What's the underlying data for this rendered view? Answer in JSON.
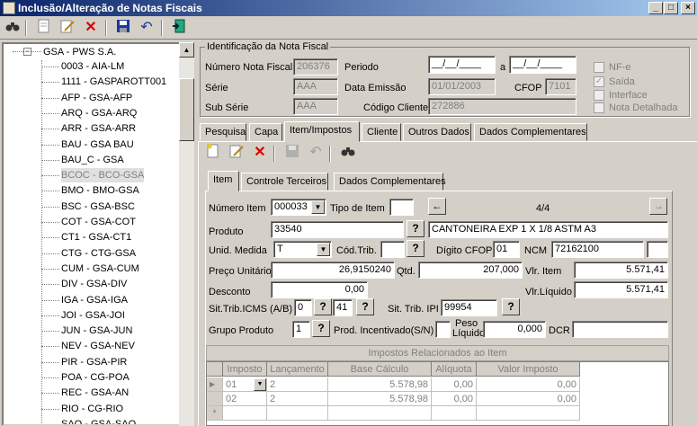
{
  "window": {
    "title": "Inclusão/Alteração de Notas Fiscais",
    "minimize": "_",
    "maximize": "□",
    "close": "×"
  },
  "toolbar": {
    "find": "find-icon",
    "new": "new-document-icon",
    "edit": "edit-icon",
    "delete": "delete-icon",
    "save": "save-icon",
    "undo": "undo-icon",
    "exit": "exit-door-icon"
  },
  "tree": {
    "root": "GSA - PWS S.A.",
    "items": [
      "0003 - AIA-LM",
      "1111 - GASPAROTT001",
      "AFP - GSA-AFP",
      "ARQ - GSA-ARQ",
      "ARR - GSA-ARR",
      "BAU - GSA BAU",
      "BAU_C - GSA",
      "BCOC - BCO-GSA",
      "BMO - BMO-GSA",
      "BSC - GSA-BSC",
      "COT - GSA-COT",
      "CT1 - GSA-CT1",
      "CTG - CTG-GSA",
      "CUM - GSA-CUM",
      "DIV - GSA-DIV",
      "IGA - GSA-IGA",
      "JOI - GSA-JOI",
      "JUN - GSA-JUN",
      "NEV - GSA-NEV",
      "PIR - GSA-PIR",
      "POA - CG-POA",
      "REC - GSA-AN",
      "RIO - CG-RIO",
      "SAO - GSA-SAO"
    ],
    "selected_index": 7
  },
  "ident": {
    "legend": "Identificação da Nota Fiscal",
    "numero_label": "Número Nota Fiscal",
    "numero": "206376",
    "periodo_label": "Periodo",
    "periodo_de": "__/__/____",
    "periodo_a_label": "a",
    "periodo_ate": "__/__/____",
    "serie_label": "Série",
    "serie": "AAA",
    "data_emissao_label": "Data Emissão",
    "data_emissao": "01/01/2003",
    "cfop_label": "CFOP",
    "cfop": "7101",
    "sub_serie_label": "Sub Série",
    "sub_serie": "AAA",
    "codigo_cliente_label": "Código Cliente",
    "codigo_cliente": "272886",
    "checks": [
      {
        "label": "NF-e",
        "checked": false
      },
      {
        "label": "Saída",
        "checked": true
      },
      {
        "label": "Interface",
        "checked": false
      },
      {
        "label": "Nota Detalhada",
        "checked": false
      }
    ]
  },
  "tabs": [
    "Pesquisa",
    "Capa",
    "Item/Impostos",
    "Cliente",
    "Outros Dados",
    "Dados Complementares"
  ],
  "subtoolbar": {
    "new": "new-item-icon",
    "edit": "edit-item-icon",
    "delete": "delete-item-icon",
    "save": "save-item-icon",
    "undo": "undo-item-icon",
    "find": "find-item-icon"
  },
  "subtabs": [
    "Item",
    "Controle Terceiros",
    "Dados Complementares"
  ],
  "item": {
    "numero_item_label": "Número Item",
    "numero_item": "000033",
    "tipo_item_label": "Tipo de Item",
    "tipo_item": "",
    "counter": "4/4",
    "produto_label": "Produto",
    "produto": "33540",
    "produto_desc": "CANTONEIRA EXP 1 X 1/8 ASTM A3",
    "unid_medida_label": "Unid. Medida",
    "unid_medida": "T",
    "cod_trib_label": "Cód.Trib.",
    "cod_trib": "",
    "digito_cfop_label": "Dígito CFOP",
    "digito_cfop": "01",
    "ncm_label": "NCM",
    "ncm": "72162100",
    "ncm_extra": "",
    "preco_label": "Preço Unitário",
    "preco": "26,9150240",
    "qtd_label": "Qtd.",
    "qtd": "207,000",
    "vlr_item_label": "Vlr. Item",
    "vlr_item": "5.571,41",
    "desconto_label": "Desconto",
    "desconto": "0,00",
    "vlr_liquido_label": "Vlr.Líquido",
    "vlr_liquido": "5.571,41",
    "sit_icms_label": "Sit.Trib.ICMS (A/B)",
    "sit_icms_a": "0",
    "sit_icms_b": "41",
    "sit_ipi_label": "Sit. Trib. IPI",
    "sit_ipi": "99954",
    "grupo_label": "Grupo Produto",
    "grupo": "1",
    "prod_incent_label": "Prod. Incentivado(S/N)",
    "prod_incent": "",
    "peso_label_1": "Peso",
    "peso_label_2": "Líquido",
    "peso": "0,000",
    "dcr_label": "DCR",
    "dcr": "",
    "btn_q": "?"
  },
  "impostos": {
    "caption": "Impostos Relacionados ao Item",
    "columns": [
      "Imposto",
      "Lançamento",
      "Base Cálculo",
      "Alíquota",
      "Valor Imposto"
    ],
    "rows": [
      [
        "01",
        "2",
        "5.578,98",
        "0,00",
        "0,00"
      ],
      [
        "02",
        "2",
        "5.578,98",
        "0,00",
        "0,00"
      ]
    ],
    "new_row": "*"
  }
}
